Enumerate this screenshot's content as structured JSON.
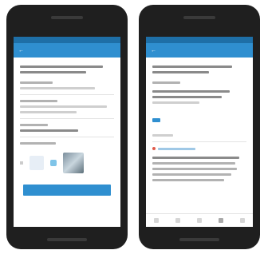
{
  "left_phone": {
    "appbar_title": "",
    "button_label": ""
  },
  "right_phone": {
    "appbar_title": ""
  }
}
